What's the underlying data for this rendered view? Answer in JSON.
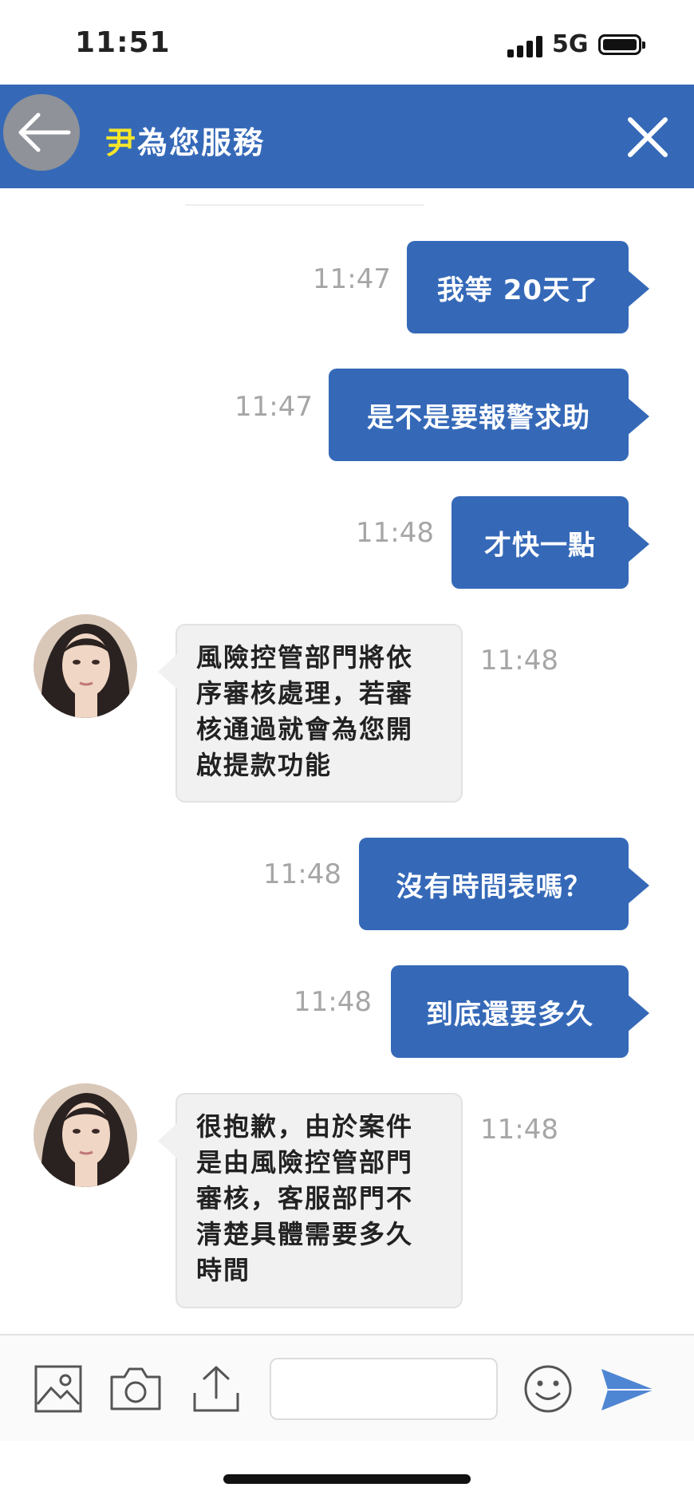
{
  "status_bar": {
    "time": "11:51",
    "network": "5G"
  },
  "header": {
    "title_glyph": "尹",
    "title": "為您服務"
  },
  "messages": [
    {
      "side": "out",
      "text": "我等 20天了",
      "time": "11:47"
    },
    {
      "side": "out",
      "text": "是不是要報警求助",
      "time": "11:47"
    },
    {
      "side": "out",
      "text": "才快一點",
      "time": "11:48"
    },
    {
      "side": "in",
      "lines": [
        "風險控管部門將依",
        "序審核處理，若審",
        "核通過就會為您開",
        "啟提款功能"
      ],
      "time": "11:48"
    },
    {
      "side": "out",
      "text": "沒有時間表嗎？",
      "time": "11:48"
    },
    {
      "side": "out",
      "text": "到底還要多久",
      "time": "11:48"
    },
    {
      "side": "in",
      "lines": [
        "很抱歉，由於案件",
        "是由風險控管部門",
        "審核，客服部門不",
        "清楚具體需要多久",
        "時間"
      ],
      "time": "11:48"
    }
  ],
  "input_bar": {
    "placeholder": ""
  },
  "colors": {
    "header": "#3569b8",
    "bubble_out": "#3569b8",
    "bubble_in": "#f1f1f1",
    "timestamp": "#a6a6a6"
  },
  "icons": [
    "back-arrow-icon",
    "close-icon",
    "image-icon",
    "camera-icon",
    "upload-icon",
    "emoji-icon",
    "send-icon"
  ]
}
